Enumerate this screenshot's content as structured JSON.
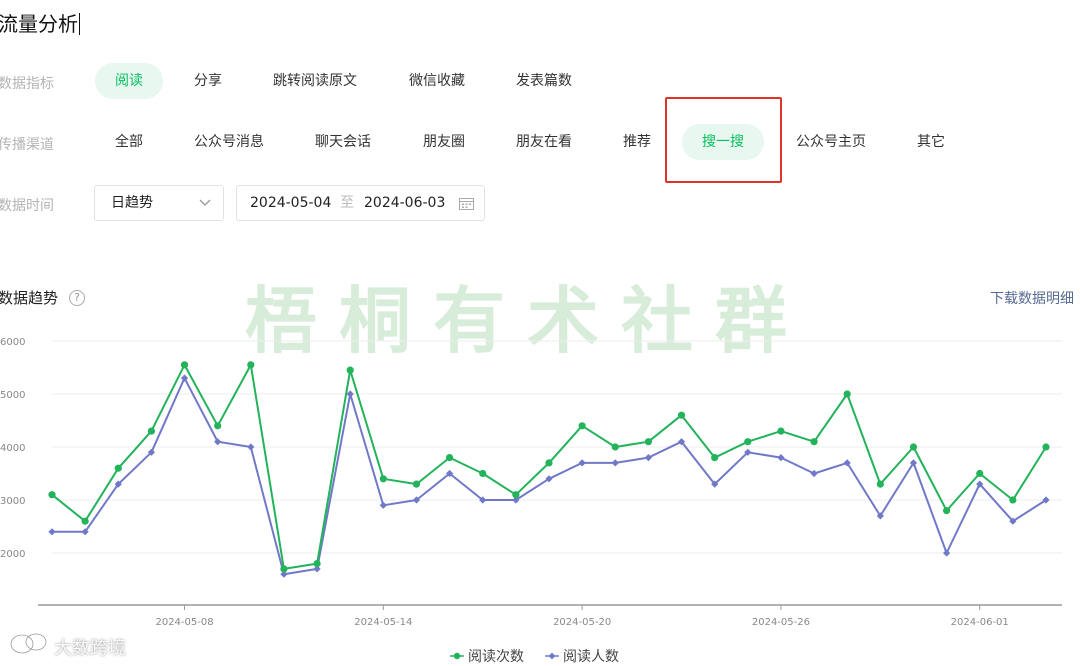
{
  "page": {
    "title": "流量分析"
  },
  "filters": {
    "metric": {
      "label": "数据指标",
      "options": [
        "阅读",
        "分享",
        "跳转阅读原文",
        "微信收藏",
        "发表篇数"
      ],
      "active_index": 0
    },
    "channel": {
      "label": "传播渠道",
      "options": [
        "全部",
        "公众号消息",
        "聊天会话",
        "朋友圈",
        "朋友在看",
        "推荐",
        "搜一搜",
        "公众号主页",
        "其它"
      ],
      "active_index": 6
    },
    "time": {
      "label": "数据时间",
      "mode": "日趋势",
      "start_date": "2024-05-04",
      "separator": "至",
      "end_date": "2024-06-03"
    }
  },
  "section": {
    "title": "数据趋势",
    "help_glyph": "?",
    "download_label": "下载数据明细"
  },
  "watermark": {
    "text": "梧桐有术社群",
    "corner_text": "大数跨境"
  },
  "icons": {
    "dropdown": "chevron-down-icon",
    "calendar": "calendar-icon",
    "help": "question-circle-icon"
  },
  "colors": {
    "accent": "#07c160",
    "active_bg": "#e8f7ef",
    "series_reads": "#22b35b",
    "series_readers": "#7078c8",
    "annotation": "#e0342b",
    "link": "#576b95"
  },
  "chart_data": {
    "type": "line",
    "x": [
      "2024-05-04",
      "2024-05-05",
      "2024-05-06",
      "2024-05-07",
      "2024-05-08",
      "2024-05-09",
      "2024-05-10",
      "2024-05-11",
      "2024-05-12",
      "2024-05-13",
      "2024-05-14",
      "2024-05-15",
      "2024-05-16",
      "2024-05-17",
      "2024-05-18",
      "2024-05-19",
      "2024-05-20",
      "2024-05-21",
      "2024-05-22",
      "2024-05-23",
      "2024-05-24",
      "2024-05-25",
      "2024-05-26",
      "2024-05-27",
      "2024-05-28",
      "2024-05-29",
      "2024-05-30",
      "2024-05-31",
      "2024-06-01",
      "2024-06-02",
      "2024-06-03"
    ],
    "x_tick_labels": [
      "2024-05-08",
      "2024-05-14",
      "2024-05-20",
      "2024-05-26",
      "2024-06-01"
    ],
    "y_tick_labels": [
      "2000",
      "3000",
      "4000",
      "5000",
      "6000"
    ],
    "ylim": [
      1000,
      6000
    ],
    "series": [
      {
        "name": "阅读次数",
        "values": [
          3100,
          2600,
          3600,
          4300,
          5550,
          4400,
          5550,
          1700,
          1800,
          5450,
          3400,
          3300,
          3800,
          3500,
          3100,
          3700,
          4400,
          4000,
          4100,
          4600,
          3800,
          4100,
          4300,
          4100,
          5000,
          3300,
          4000,
          2800,
          3500,
          3000,
          4000
        ]
      },
      {
        "name": "阅读人数",
        "values": [
          2400,
          2400,
          3300,
          3900,
          5300,
          4100,
          4000,
          1600,
          1700,
          5000,
          2900,
          3000,
          3500,
          3000,
          3000,
          3400,
          3700,
          3700,
          3800,
          4100,
          3300,
          3900,
          3800,
          3500,
          3700,
          2700,
          3700,
          2000,
          3300,
          2600,
          3000
        ]
      }
    ],
    "legend_position": "bottom"
  }
}
